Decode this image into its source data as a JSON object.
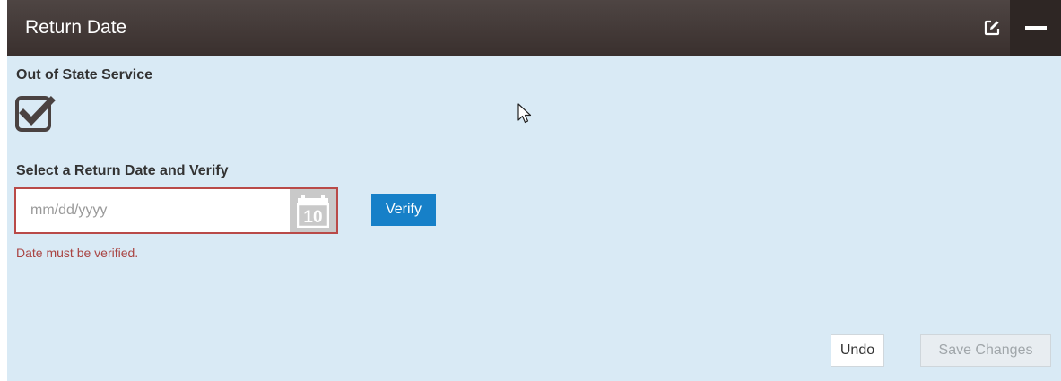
{
  "header": {
    "title": "Return Date",
    "edit_icon": "edit-icon",
    "collapse_icon": "minus-icon"
  },
  "out_of_state": {
    "label": "Out of State Service",
    "checked": true,
    "icon": "checkbox-checked-icon"
  },
  "return_date": {
    "label": "Select a Return Date and Verify",
    "value": "",
    "placeholder": "mm/dd/yyyy",
    "calendar_icon": "calendar-icon",
    "calendar_day": "10",
    "verify_label": "Verify",
    "error": "Date must be verified."
  },
  "footer": {
    "undo_label": "Undo",
    "save_label": "Save Changes",
    "save_enabled": false
  },
  "colors": {
    "header_bg": "#3a302e",
    "panel_bg": "#d9eaf5",
    "accent": "#1680c8",
    "error": "#a94442"
  }
}
